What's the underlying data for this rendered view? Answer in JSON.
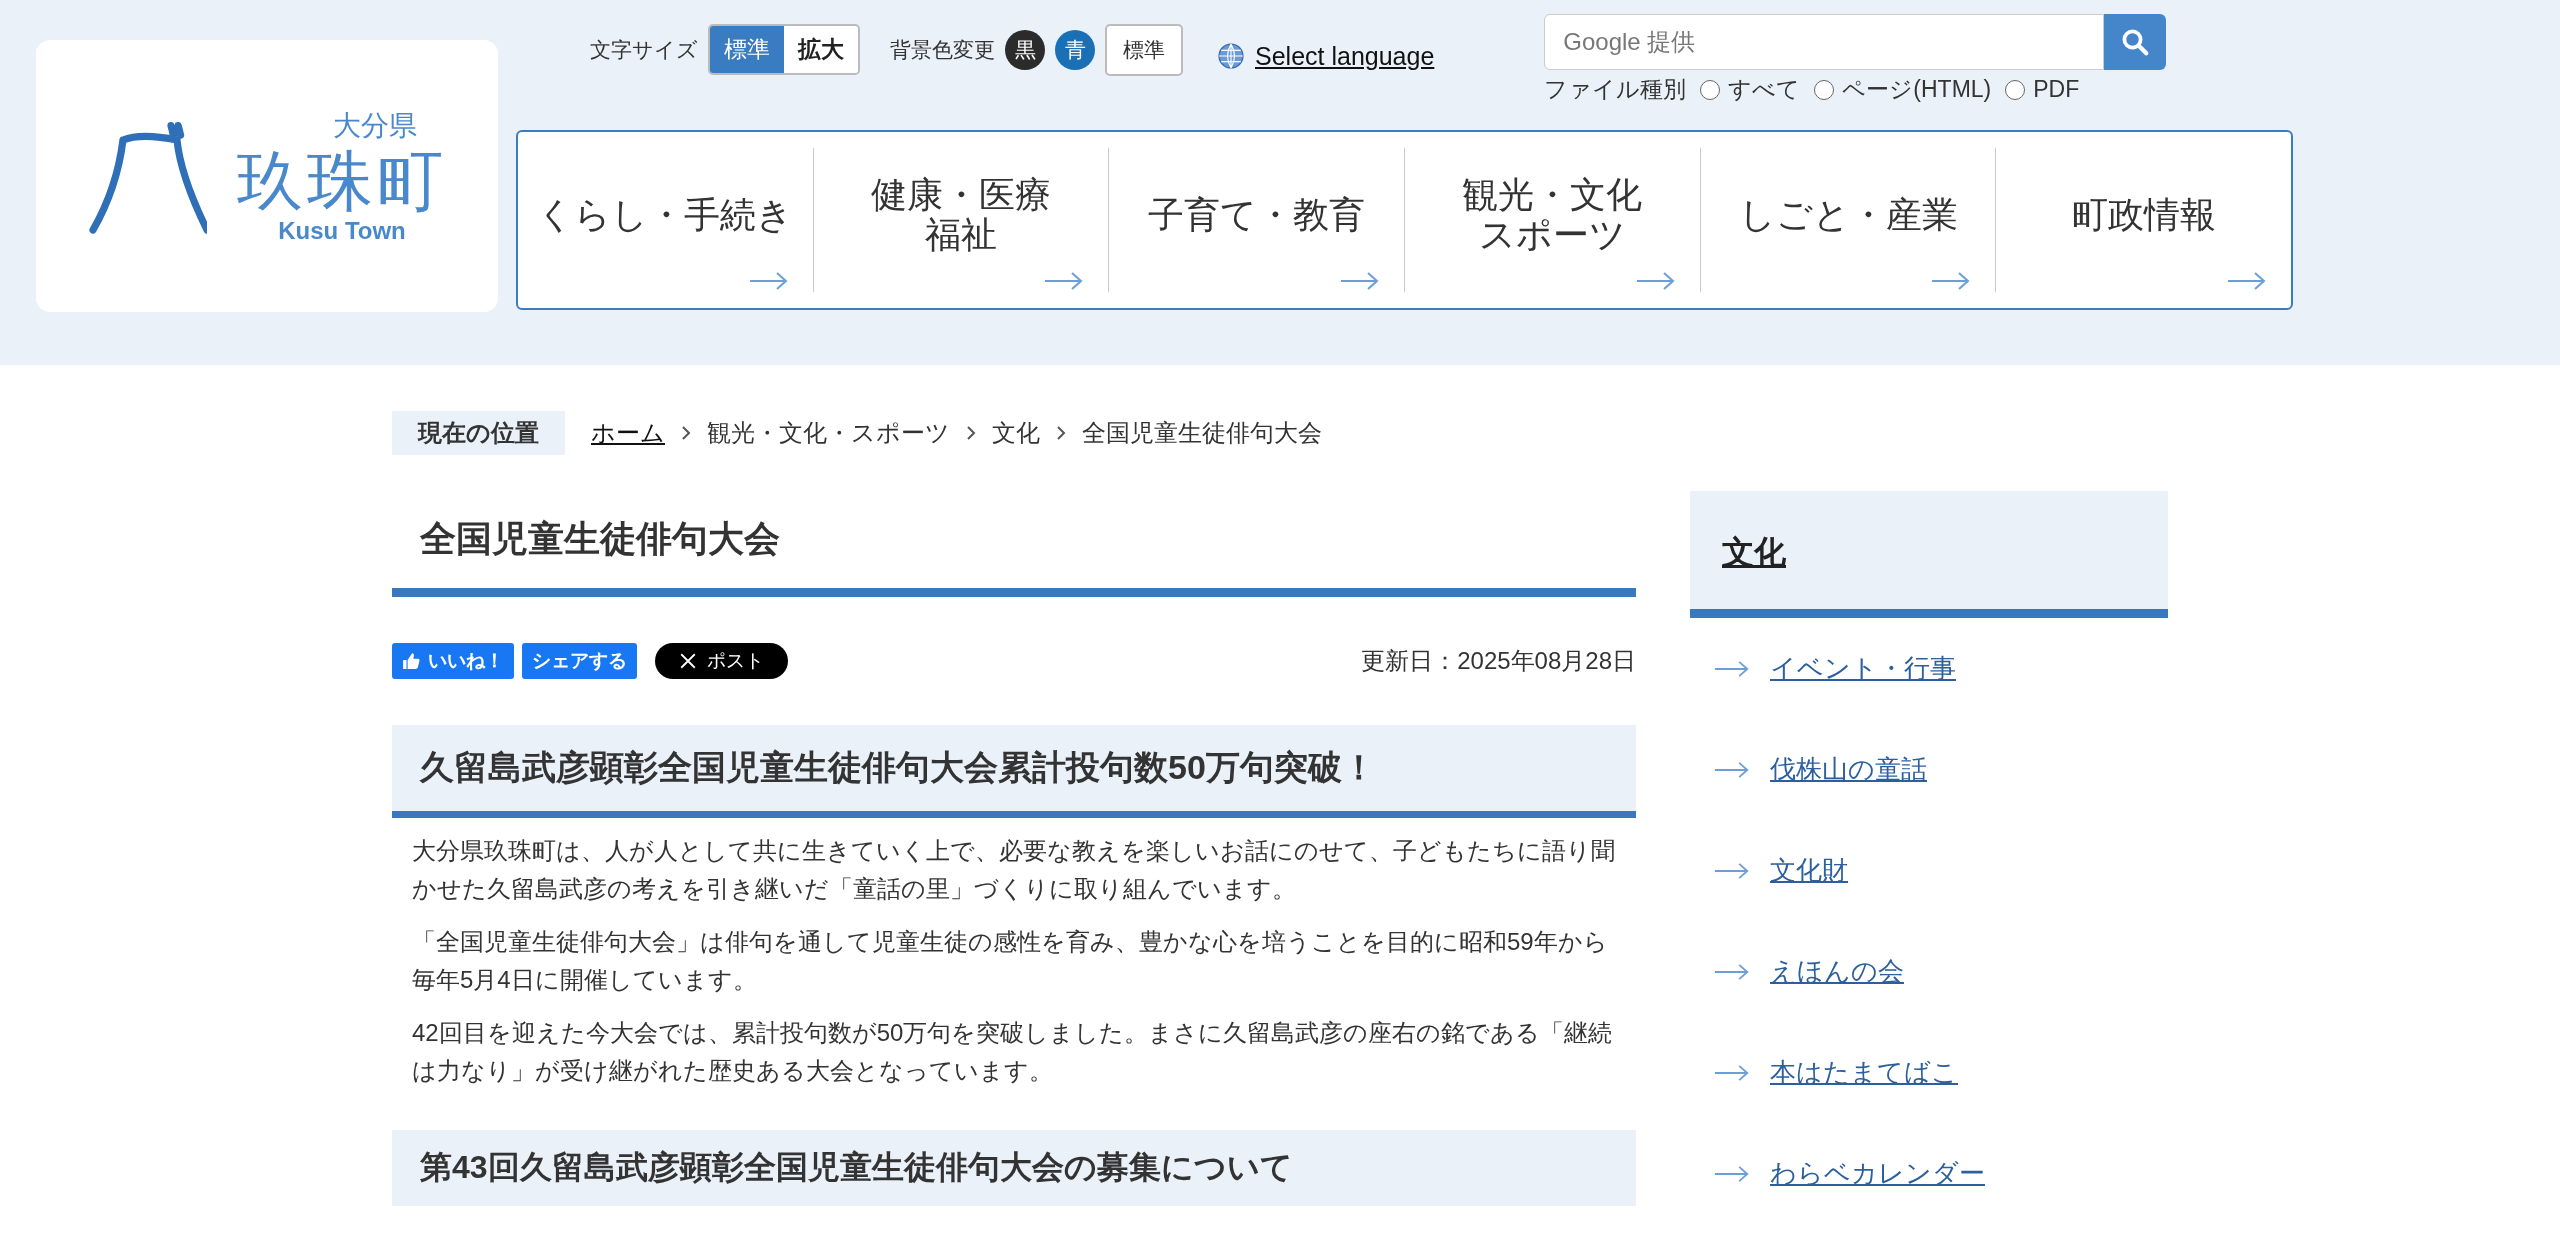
{
  "header": {
    "logo": {
      "prefecture": "大分県",
      "town": "玖珠町",
      "romaji": "Kusu Town"
    },
    "text_size": {
      "label": "文字サイズ",
      "options": [
        {
          "label": "標準",
          "selected": true
        },
        {
          "label": "拡大",
          "selected": false
        }
      ]
    },
    "background_color": {
      "label": "背景色変更",
      "options": [
        {
          "label": "黒",
          "kind": "black"
        },
        {
          "label": "青",
          "kind": "blue"
        },
        {
          "label": "標準",
          "kind": "standard"
        }
      ]
    },
    "language": {
      "label": "Select language"
    },
    "search": {
      "placeholder": "Google 提供",
      "file_type": {
        "label": "ファイル種別",
        "options": [
          {
            "label": "すべて",
            "selected": false
          },
          {
            "label": "ページ(HTML)",
            "selected": false
          },
          {
            "label": "PDF",
            "selected": false
          }
        ]
      }
    }
  },
  "nav": [
    {
      "lines": [
        "くらし・手続き"
      ]
    },
    {
      "lines": [
        "健康・医療",
        "福祉"
      ]
    },
    {
      "lines": [
        "子育て・教育"
      ]
    },
    {
      "lines": [
        "観光・文化",
        "スポーツ"
      ]
    },
    {
      "lines": [
        "しごと・産業"
      ]
    },
    {
      "lines": [
        "町政情報"
      ]
    }
  ],
  "breadcrumb": {
    "label": "現在の位置",
    "items": [
      {
        "label": "ホーム",
        "kind": "link"
      },
      {
        "label": "観光・文化・スポーツ",
        "kind": "text"
      },
      {
        "label": "文化",
        "kind": "text"
      },
      {
        "label": "全国児童生徒俳句大会",
        "kind": "text"
      }
    ]
  },
  "article": {
    "title": "全国児童生徒俳句大会",
    "share": [
      {
        "label": "いいね！",
        "kind": "like"
      },
      {
        "label": "シェアする",
        "kind": "share"
      },
      {
        "label": "ポスト",
        "kind": "post"
      }
    ],
    "updated": "更新日：2025年08月28日",
    "sections": [
      {
        "heading": "久留島武彦顕彰全国児童生徒俳句大会累計投句数50万句突破！",
        "paragraphs": [
          "大分県玖珠町は、人が人として共に生きていく上で、必要な教えを楽しいお話にのせて、子どもたちに語り聞かせた久留島武彦の考えを引き継いだ「童話の里」づくりに取り組んでいます。",
          "「全国児童生徒俳句大会」は俳句を通して児童生徒の感性を育み、豊かな心を培うことを目的に昭和59年から毎年5月4日に開催しています。",
          "42回目を迎えた今大会では、累計投句数が50万句を突破しました。まさに久留島武彦の座右の銘である「継続は力なり」が受け継がれた歴史ある大会となっています。"
        ]
      },
      {
        "heading": "第43回久留島武彦顕彰全国児童生徒俳句大会の募集について"
      }
    ]
  },
  "sidebar": {
    "heading": "文化",
    "links": [
      "イベント・行事",
      "伐株山の童話",
      "文化財",
      "えほんの会",
      "本はたまてばこ",
      "わらベカレンダー"
    ]
  }
}
